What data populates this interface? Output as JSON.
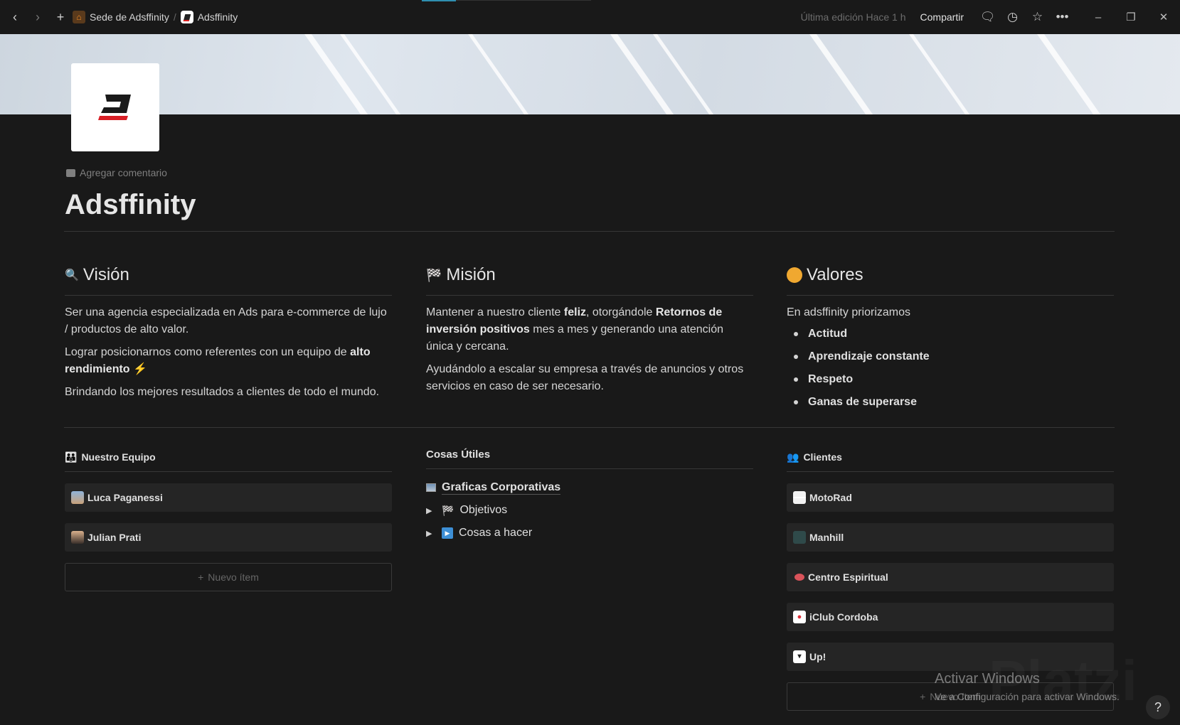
{
  "topbar": {
    "breadcrumb": [
      "Sede de Adsffinity",
      "Adsffinity"
    ],
    "separator": "/",
    "last_edited": "Última edición Hace 1 h",
    "share": "Compartir"
  },
  "page": {
    "add_comment": "Agregar comentario",
    "title": "Adsffinity"
  },
  "vision": {
    "title": "Visión",
    "p1": "Ser una agencia especializada en Ads para e-commerce de lujo / productos de alto valor.",
    "p2_pre": "Lograr posicionarnos como referentes con un equipo de ",
    "p2_bold": "alto rendimiento",
    "p2_emoji": "⚡",
    "p3": "Brindando los mejores resultados a clientes de todo el mundo."
  },
  "mision": {
    "title": "Misión",
    "p1_a": "Mantener a nuestro cliente ",
    "p1_b": "feliz",
    "p1_c": ", otorgándole ",
    "p1_d": "Retornos de inversión positivos",
    "p1_e": " mes a mes y generando una atención única y cercana.",
    "p2": "Ayudándolo a escalar su empresa a través de anuncios y otros servicios en caso de ser necesario."
  },
  "valores": {
    "title": "Valores",
    "intro": "En adsffinity priorizamos",
    "items": [
      "Actitud",
      "Aprendizaje constante",
      "Respeto",
      "Ganas de superarse"
    ]
  },
  "equipo": {
    "title": "Nuestro Equipo",
    "items": [
      "Luca Paganessi",
      "Julian Prati"
    ],
    "new_item": "Nuevo ítem"
  },
  "utiles": {
    "title": "Cosas Útiles",
    "link": "Graficas Corporativas",
    "toggles": [
      "Objetivos",
      "Cosas a hacer"
    ]
  },
  "clientes": {
    "title": "Clientes",
    "items": [
      "MotoRad",
      "Manhill",
      "Centro Espiritual",
      "iClub Cordoba",
      "Up!"
    ],
    "new_item": "Nuevo ítem"
  },
  "overlay": {
    "activate_title": "Activar Windows",
    "activate_sub": "Ve a Configuración para activar Windows.",
    "platzi": "Platzi",
    "help": "?"
  }
}
